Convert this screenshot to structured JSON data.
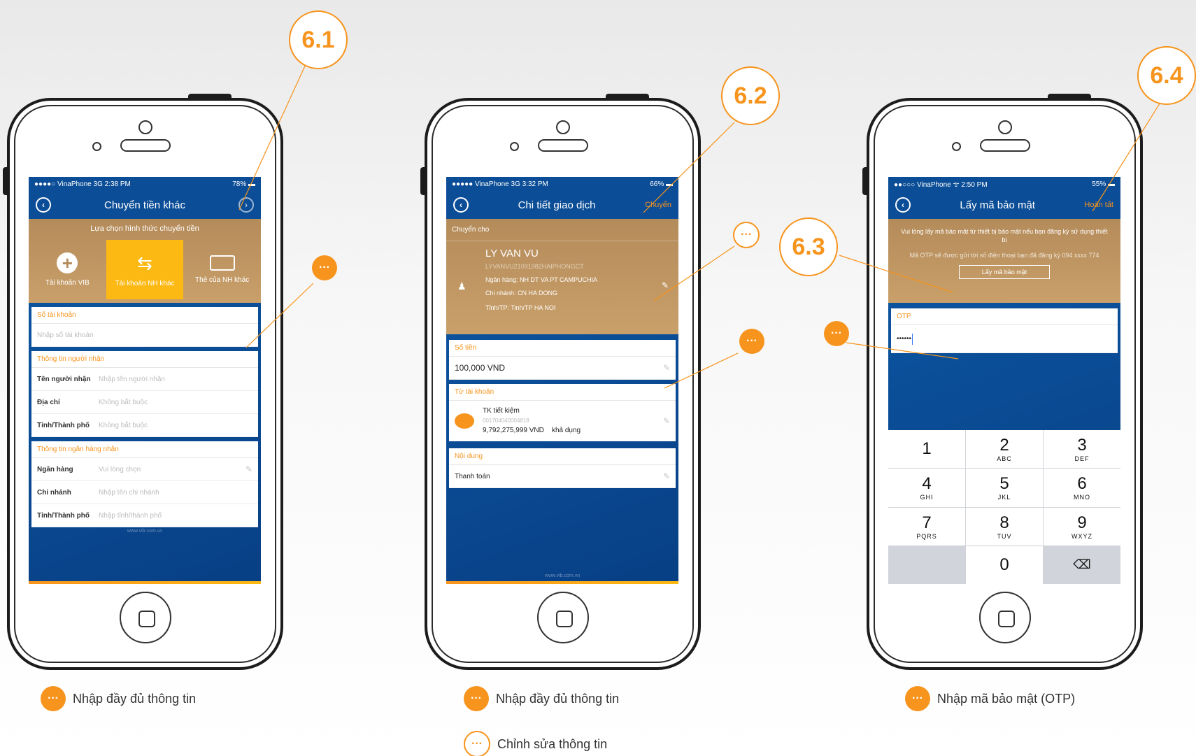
{
  "colors": {
    "accent": "#f7941d",
    "primary_blue": "#0b4d96",
    "gold": "#c9a06a"
  },
  "callouts": {
    "c61": "6.1",
    "c62": "6.2",
    "c63": "6.3",
    "c64": "6.4",
    "dots": "···"
  },
  "phone1": {
    "status": {
      "carrier": "●●●●○ VinaPhone  3G  2:38 PM",
      "battery": "78% ▬"
    },
    "nav": {
      "title": "Chuyển tiền khác"
    },
    "section_title": "Lựa chọn hình thức chuyển tiền",
    "options": [
      {
        "icon": "plus-circle-icon",
        "label": "Tài khoản VIB"
      },
      {
        "icon": "transfer-icon",
        "label": "Tài khoản NH khác"
      },
      {
        "icon": "card-icon",
        "label": "Thẻ của NH khác"
      }
    ],
    "account": {
      "header": "Số tài khoản",
      "placeholder": "Nhập số tài khoản"
    },
    "recipient": {
      "header": "Thông tin người nhận",
      "rows": [
        {
          "k": "Tên người nhận",
          "v": "Nhập tên người nhận"
        },
        {
          "k": "Địa chỉ",
          "v": "Không bắt buộc"
        },
        {
          "k": "Tỉnh/Thành phố",
          "v": "Không bắt buộc"
        }
      ]
    },
    "bank": {
      "header": "Thông tin ngân hàng nhận",
      "rows": [
        {
          "k": "Ngân hàng",
          "v": "Vui lòng chọn"
        },
        {
          "k": "Chi nhánh",
          "v": "Nhập tên chi nhánh"
        },
        {
          "k": "Tỉnh/Thành phố",
          "v": "Nhập tỉnh/thành phố"
        }
      ]
    },
    "footer_url": "www.vib.com.vn"
  },
  "phone2": {
    "status": {
      "carrier": "●●●●● VinaPhone  3G  3:32 PM",
      "battery": "66% ▬"
    },
    "nav": {
      "title": "Chi tiết giao dịch",
      "action": "Chuyển"
    },
    "to_label": "Chuyển cho",
    "recipient": {
      "name": "LY VAN VU",
      "code": "LYVANVU21091982HAIPHONGCT",
      "bank": "Ngân hàng: NH DT VA PT CAMPUCHIA",
      "branch": "Chi nhánh: CN HA DONG",
      "province": "Tỉnh/TP: Tinh/TP HA NOI"
    },
    "amount": {
      "header": "Số tiền",
      "value": "100,000  VND"
    },
    "from": {
      "header": "Từ tài khoản",
      "name": "TK tiết kiệm",
      "number": "001704040004818",
      "balance": "9,792,275,999 VND",
      "avail": "khả dụng"
    },
    "content": {
      "header": "Nội dung",
      "value": "Thanh toán"
    },
    "footer_url": "www.vib.com.vn"
  },
  "phone3": {
    "status": {
      "carrier": "●●○○○ VinaPhone  ᯤ  2:50 PM",
      "battery": "55% ▬"
    },
    "nav": {
      "title": "Lấy mã bảo mật",
      "action": "Hoàn tất"
    },
    "notice1": "Vui lòng lấy mã bảo mật từ thiết bị bảo mật nếu bạn đăng ký sử dụng thiết bị",
    "notice2": "Mã OTP sẽ được gửi tới số điện thoại bạn đã đăng ký 094 xxxx 774",
    "get_code_button": "Lấy mã bảo mật",
    "otp": {
      "header": "OTP",
      "value": "••••••"
    },
    "keys": [
      {
        "n": "1",
        "l": ""
      },
      {
        "n": "2",
        "l": "ABC"
      },
      {
        "n": "3",
        "l": "DEF"
      },
      {
        "n": "4",
        "l": "GHI"
      },
      {
        "n": "5",
        "l": "JKL"
      },
      {
        "n": "6",
        "l": "MNO"
      },
      {
        "n": "7",
        "l": "PQRS"
      },
      {
        "n": "8",
        "l": "TUV"
      },
      {
        "n": "9",
        "l": "WXYZ"
      },
      {
        "n": "",
        "l": ""
      },
      {
        "n": "0",
        "l": ""
      },
      {
        "n": "⌫",
        "l": ""
      }
    ]
  },
  "captions": {
    "p1": "Nhập đầy đủ thông tin",
    "p2_fill": "Nhập đầy đủ thông tin",
    "p2_edit": "Chỉnh sửa thông tin",
    "p3": "Nhập mã bảo mật (OTP)"
  }
}
